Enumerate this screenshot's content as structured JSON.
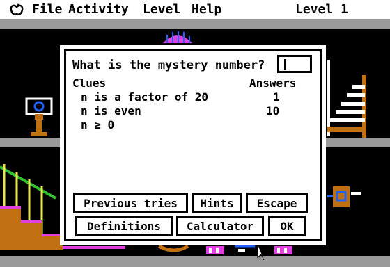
{
  "menu": {
    "apple_icon": "apple-icon",
    "items": [
      "File",
      "Activity",
      "Level",
      "Help"
    ],
    "level_label": "Level 1"
  },
  "dialog": {
    "question": "What is the mystery number?",
    "answer_value": "",
    "clues_header": "Clues",
    "answers_header": "Answers",
    "clues": [
      "n is a factor of 20",
      "n is even",
      "n ≥ 0"
    ],
    "answers": [
      "1",
      "10"
    ],
    "buttons": {
      "previous_tries": "Previous tries",
      "hints": "Hints",
      "escape": "Escape",
      "definitions": "Definitions",
      "calculator": "Calculator",
      "ok": "OK"
    }
  },
  "colors": {
    "background": "#000000",
    "menubar": "#ffffff",
    "floor": "#9a9a9a",
    "magenta": "#e040e0",
    "green": "#30c030",
    "orange": "#c07010",
    "blue": "#2060ff"
  }
}
